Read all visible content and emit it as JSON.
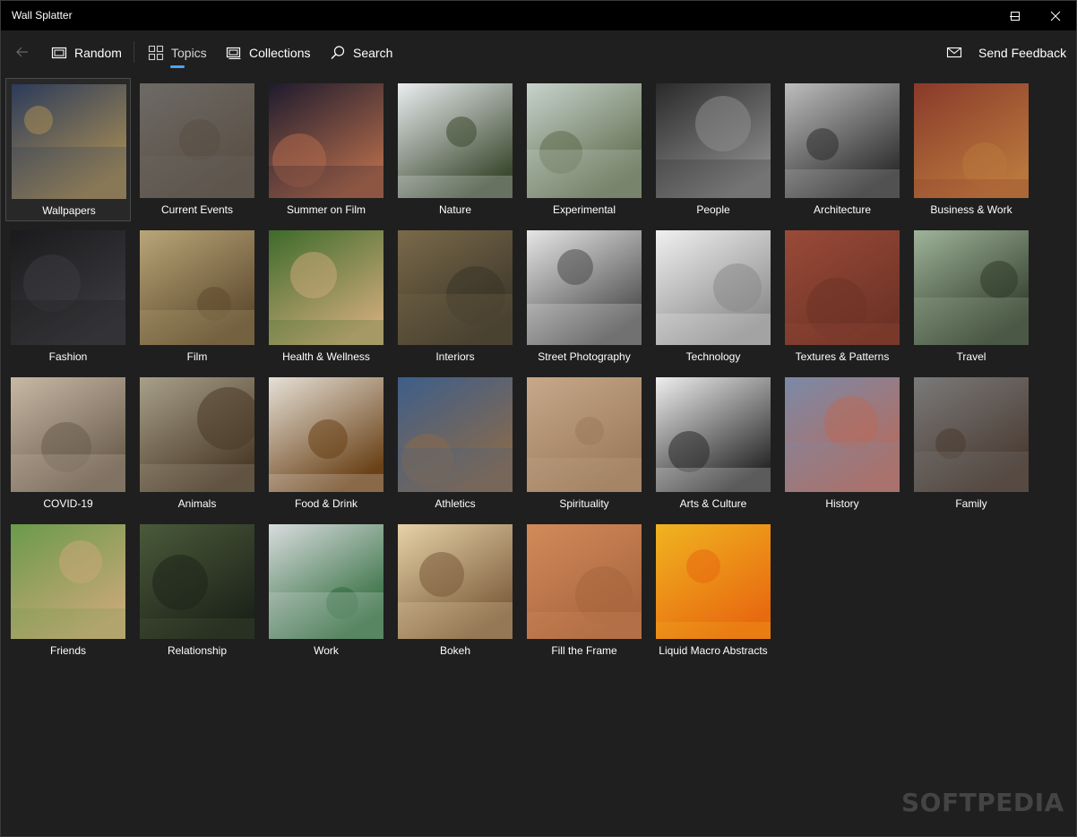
{
  "app": {
    "title": "Wall Splatter"
  },
  "nav": {
    "random": "Random",
    "topics": "Topics",
    "collections": "Collections",
    "search": "Search",
    "feedback": "Send Feedback"
  },
  "tiles": [
    {
      "label": "Wallpapers",
      "c1": "#2c3b5a",
      "c2": "#a88d55"
    },
    {
      "label": "Current Events",
      "c1": "#6d6a66",
      "c2": "#5a4e43"
    },
    {
      "label": "Summer on Film",
      "c1": "#1e1b2e",
      "c2": "#b06a4a"
    },
    {
      "label": "Nature",
      "c1": "#e9edf0",
      "c2": "#3c4a30"
    },
    {
      "label": "Experimental",
      "c1": "#c7d3cc",
      "c2": "#5e6b4c"
    },
    {
      "label": "People",
      "c1": "#2a2a2a",
      "c2": "#8c8c8c"
    },
    {
      "label": "Architecture",
      "c1": "#bdbdbd",
      "c2": "#2e2e2e"
    },
    {
      "label": "Business & Work",
      "c1": "#8a3a2a",
      "c2": "#b8773d"
    },
    {
      "label": "Fashion",
      "c1": "#1a1a1c",
      "c2": "#3b3b40"
    },
    {
      "label": "Film",
      "c1": "#b9a678",
      "c2": "#5e4a2e"
    },
    {
      "label": "Health & Wellness",
      "c1": "#3d6b2a",
      "c2": "#c9a878"
    },
    {
      "label": "Interiors",
      "c1": "#7a6a4a",
      "c2": "#3a3428"
    },
    {
      "label": "Street Photography",
      "c1": "#e6e6e6",
      "c2": "#4a4a4a"
    },
    {
      "label": "Technology",
      "c1": "#f0f0f0",
      "c2": "#8a8a8a"
    },
    {
      "label": "Textures & Patterns",
      "c1": "#9a4a38",
      "c2": "#6e3326"
    },
    {
      "label": "Travel",
      "c1": "#9fb39a",
      "c2": "#2e3a28"
    },
    {
      "label": "COVID-19",
      "c1": "#c8b9a6",
      "c2": "#6a5c4c"
    },
    {
      "label": "Animals",
      "c1": "#a8a08a",
      "c2": "#4a3a28"
    },
    {
      "label": "Food & Drink",
      "c1": "#e6e0d6",
      "c2": "#6a4218"
    },
    {
      "label": "Athletics",
      "c1": "#3d5e8a",
      "c2": "#8a6a4a"
    },
    {
      "label": "Spirituality",
      "c1": "#c8a88a",
      "c2": "#9a7a5a"
    },
    {
      "label": "Arts & Culture",
      "c1": "#eeeeee",
      "c2": "#2a2a2a"
    },
    {
      "label": "History",
      "c1": "#7a8aa8",
      "c2": "#b86a5a"
    },
    {
      "label": "Family",
      "c1": "#7a7a7a",
      "c2": "#4a3a30"
    },
    {
      "label": "Friends",
      "c1": "#6a9a4a",
      "c2": "#c8a878"
    },
    {
      "label": "Relationship",
      "c1": "#4a5a3a",
      "c2": "#1e241a"
    },
    {
      "label": "Work",
      "c1": "#d8dcde",
      "c2": "#2e6a3a"
    },
    {
      "label": "Bokeh",
      "c1": "#e6d2a8",
      "c2": "#7a5a3a"
    },
    {
      "label": "Fill the Frame",
      "c1": "#d28a5a",
      "c2": "#a8663e"
    },
    {
      "label": "Liquid Macro Abstracts",
      "c1": "#f0b420",
      "c2": "#e86a10"
    }
  ],
  "watermark": "SOFTPEDIA"
}
